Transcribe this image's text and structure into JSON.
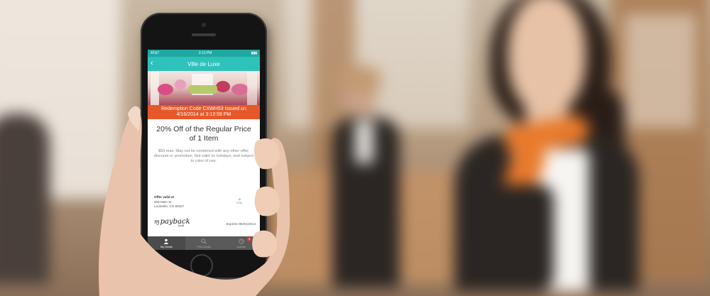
{
  "status": {
    "carrier": "AT&T",
    "time": "3:13 PM"
  },
  "nav": {
    "title": "Ville de Luxe",
    "back_icon": "chevron-left-icon"
  },
  "deal": {
    "redemption": "Redemption Code CXWH53 Issued on 4/16/2014 at 3:12:59 PM",
    "title": "20% Off of the Regular Price of 1 Item",
    "terms": "$50 max. May not be combined with any other offer, discount or promotion. Not valid on holidays, and subject to rules of use."
  },
  "location": {
    "header": "Offer valid at",
    "street": "909 Main St",
    "city": "Louisville, CO 80027"
  },
  "brand": {
    "name": "payback",
    "sub": "local"
  },
  "expires": "Expires 08/31/2014",
  "tabs": [
    {
      "label": "My Deals",
      "icon": "person-icon",
      "active": true
    },
    {
      "label": "Find Deals",
      "icon": "search-icon",
      "active": false
    },
    {
      "label": "Activity",
      "icon": "clock-icon",
      "active": false,
      "badge": "3"
    }
  ],
  "colors": {
    "accent": "#2ec2bb",
    "banner": "#e6582a",
    "tabbar": "#5a5a5a"
  }
}
